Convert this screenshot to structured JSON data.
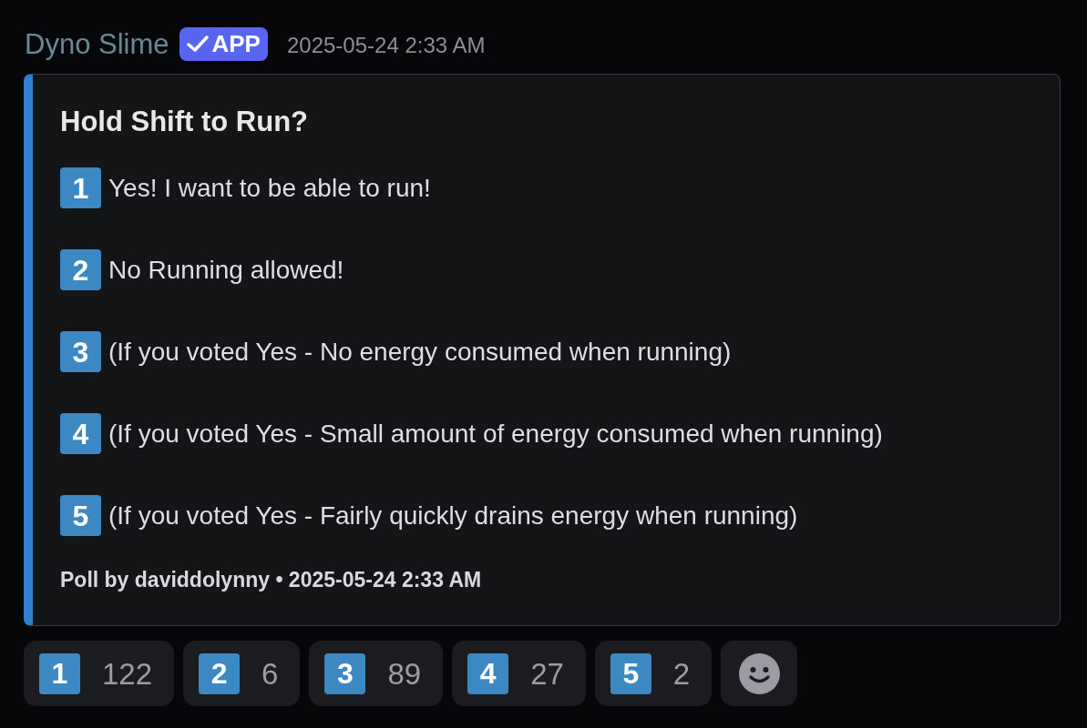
{
  "message": {
    "author": {
      "name": "Dyno Slime",
      "badge": "APP",
      "timestamp": "2025-05-24 2:33 AM"
    },
    "poll": {
      "question": "Hold Shift to Run?",
      "options": [
        {
          "keycap": "1",
          "text": "Yes! I want to be able to run!"
        },
        {
          "keycap": "2",
          "text": "No Running allowed!"
        },
        {
          "keycap": "3",
          "text": "(If you voted Yes - No energy consumed when running)"
        },
        {
          "keycap": "4",
          "text": "(If you voted Yes - Small amount of energy consumed when running)"
        },
        {
          "keycap": "5",
          "text": "(If you voted Yes - Fairly quickly drains energy when running)"
        }
      ],
      "footer": "Poll by daviddolynny • 2025-05-24 2:33 AM"
    },
    "reactions": [
      {
        "kind": "vote",
        "keycap": "1",
        "count": "122"
      },
      {
        "kind": "vote",
        "keycap": "2",
        "count": "6"
      },
      {
        "kind": "vote",
        "keycap": "3",
        "count": "89"
      },
      {
        "kind": "vote",
        "keycap": "4",
        "count": "27"
      },
      {
        "kind": "vote",
        "keycap": "5",
        "count": "2"
      },
      {
        "kind": "add"
      }
    ]
  }
}
